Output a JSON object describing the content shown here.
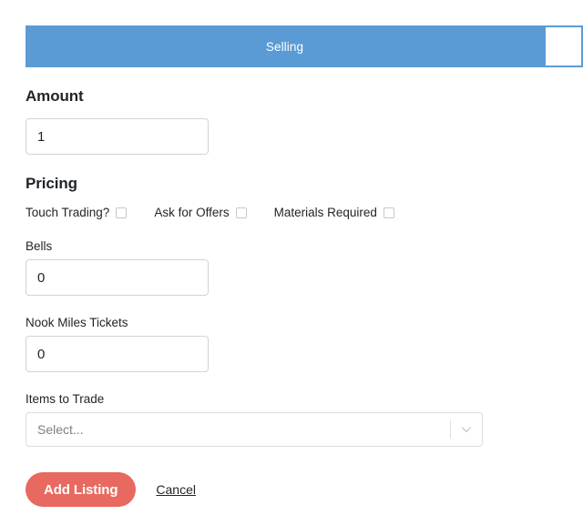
{
  "tabs": [
    {
      "label": "Selling",
      "active": true
    },
    {
      "label": "",
      "active": false
    }
  ],
  "colors": {
    "tab_active_bg": "#5b9bd5",
    "tab_border": "#5b9bd5",
    "primary_button_bg": "#e8695f",
    "input_border": "#ced4da",
    "text": "#212529",
    "placeholder": "#808080"
  },
  "amount": {
    "section_title": "Amount",
    "value": "1",
    "placeholder": "1"
  },
  "pricing": {
    "section_title": "Pricing",
    "checkboxes": [
      {
        "label": "Touch Trading?",
        "checked": false
      },
      {
        "label": "Ask for Offers",
        "checked": false
      },
      {
        "label": "Materials Required",
        "checked": false
      }
    ],
    "bells": {
      "label": "Bells",
      "value": "0",
      "placeholder": "0"
    },
    "nook_miles_tickets": {
      "label": "Nook Miles Tickets",
      "value": "0",
      "placeholder": "0"
    },
    "items_to_trade": {
      "label": "Items to Trade",
      "placeholder": "Select...",
      "value": "",
      "indicator_icon": "chevron-down-icon"
    }
  },
  "actions": {
    "submit_label": "Add Listing",
    "cancel_label": "Cancel"
  }
}
